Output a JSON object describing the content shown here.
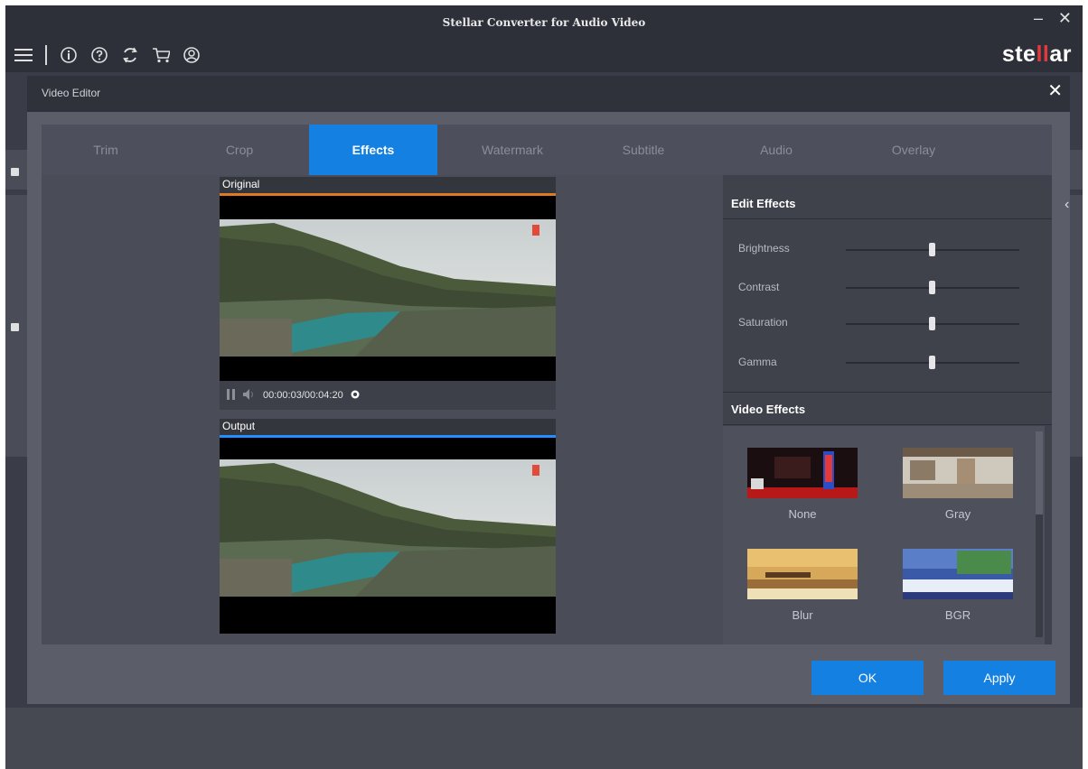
{
  "app": {
    "title": "Stellar Converter for Audio Video",
    "brand_prefix": "ste",
    "brand_mid": "ll",
    "brand_suffix": "ar",
    "minimize_glyph": "–",
    "close_glyph": "✕"
  },
  "toolbar": {
    "icons": [
      "menu-icon",
      "info-icon",
      "help-icon",
      "refresh-icon",
      "cart-icon",
      "account-icon"
    ]
  },
  "editor": {
    "title": "Video Editor",
    "close_glyph": "✕",
    "tabs": [
      {
        "label": "Trim",
        "active": false
      },
      {
        "label": "Crop",
        "active": false
      },
      {
        "label": "Effects",
        "active": true
      },
      {
        "label": "Watermark",
        "active": false
      },
      {
        "label": "Subtitle",
        "active": false
      },
      {
        "label": "Audio",
        "active": false
      },
      {
        "label": "Overlay",
        "active": false
      }
    ],
    "original_label": "Original",
    "output_label": "Output",
    "timecode": "00:00:03/00:04:20",
    "edit_effects_title": "Edit Effects",
    "sliders": [
      {
        "label": "Brightness",
        "value": 0.5
      },
      {
        "label": "Contrast",
        "value": 0.5
      },
      {
        "label": "Saturation",
        "value": 0.5
      },
      {
        "label": "Gamma",
        "value": 0.5
      }
    ],
    "video_effects_title": "Video Effects",
    "effects": [
      "None",
      "Gray",
      "Blur",
      "BGR"
    ],
    "ok_label": "OK",
    "apply_label": "Apply"
  },
  "colors": {
    "accent": "#1481e2",
    "original_bar": "#e07a22",
    "output_bar": "#1e90ff"
  }
}
